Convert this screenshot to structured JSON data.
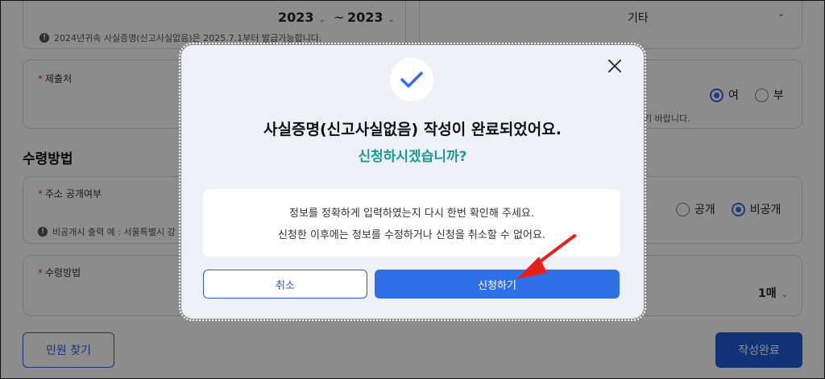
{
  "background": {
    "period": {
      "year_from": "2023",
      "tilde": "~",
      "year_to": "2023"
    },
    "period_note": "2024년귀속 사실증명(신고사실없음)은 2025.7.1부터 발급가능합니다.",
    "category_select": "기타",
    "submitter_label": "제출처",
    "submitter_note": "기 바랍니다.",
    "yes_no": {
      "yes": "여",
      "no": "부"
    },
    "receive_section_title": "수령방법",
    "address_label": "주소 공개여부",
    "address_note": "비공개시 출력 예 : 서울특별시 강",
    "address_options": {
      "public": "공개",
      "private": "비공개"
    },
    "receive_method_label": "수령방법",
    "copies_select": "1매",
    "find_petition_button": "민원 찾기",
    "complete_button": "작성완료"
  },
  "modal": {
    "title": "사실증명(신고사실없음) 작성이 완료되었어요.",
    "subtitle": "신청하시겠습니까?",
    "message_line1": "정보를 정확하게 입력하였는지 다시 한번 확인해 주세요.",
    "message_line2": "신청한 이후에는 정보를 수정하거나 신청을 취소할 수 없어요.",
    "cancel_label": "취소",
    "apply_label": "신청하기"
  },
  "colors": {
    "primary": "#2f6fe8",
    "title_teal": "#1a9a95",
    "arrow_red": "#e8201c",
    "check_blue": "#2f6fe8"
  }
}
